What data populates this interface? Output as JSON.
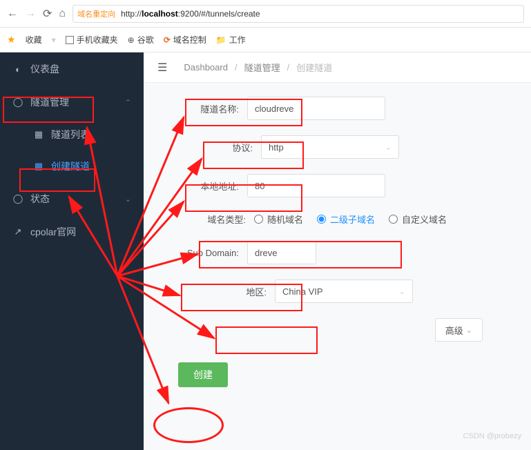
{
  "browser": {
    "redirect_tag": "域名重定向",
    "url_host": "localhost",
    "url_rest": ":9200/#/tunnels/create"
  },
  "favbar": {
    "fav": "收藏",
    "mobile": "手机收藏夹",
    "google": "谷歌",
    "domainctrl": "域名控制",
    "work": "工作"
  },
  "sidebar": {
    "dashboard": "仪表盘",
    "tunnel_mgmt": "隧道管理",
    "tunnel_list": "隧道列表",
    "tunnel_create": "创建隧道",
    "status": "状态",
    "official": "cpolar官网"
  },
  "crumb": {
    "root": "Dashboard",
    "mid": "隧道管理",
    "cur": "创建隧道"
  },
  "form": {
    "name_lbl": "隧道名称:",
    "name_val": "cloudreve",
    "proto_lbl": "协议:",
    "proto_val": "http",
    "local_lbl": "本地地址:",
    "local_val": "80",
    "domaintype_lbl": "域名类型:",
    "domaintype_opts": {
      "random": "随机域名",
      "sub": "二级子域名",
      "custom": "自定义域名"
    },
    "subdom_lbl": "Sub Domain:",
    "subdom_val": "dreve",
    "region_lbl": "地区:",
    "region_val": "China VIP",
    "advanced": "高级",
    "submit": "创建"
  },
  "watermark": "CSDN @probezy"
}
